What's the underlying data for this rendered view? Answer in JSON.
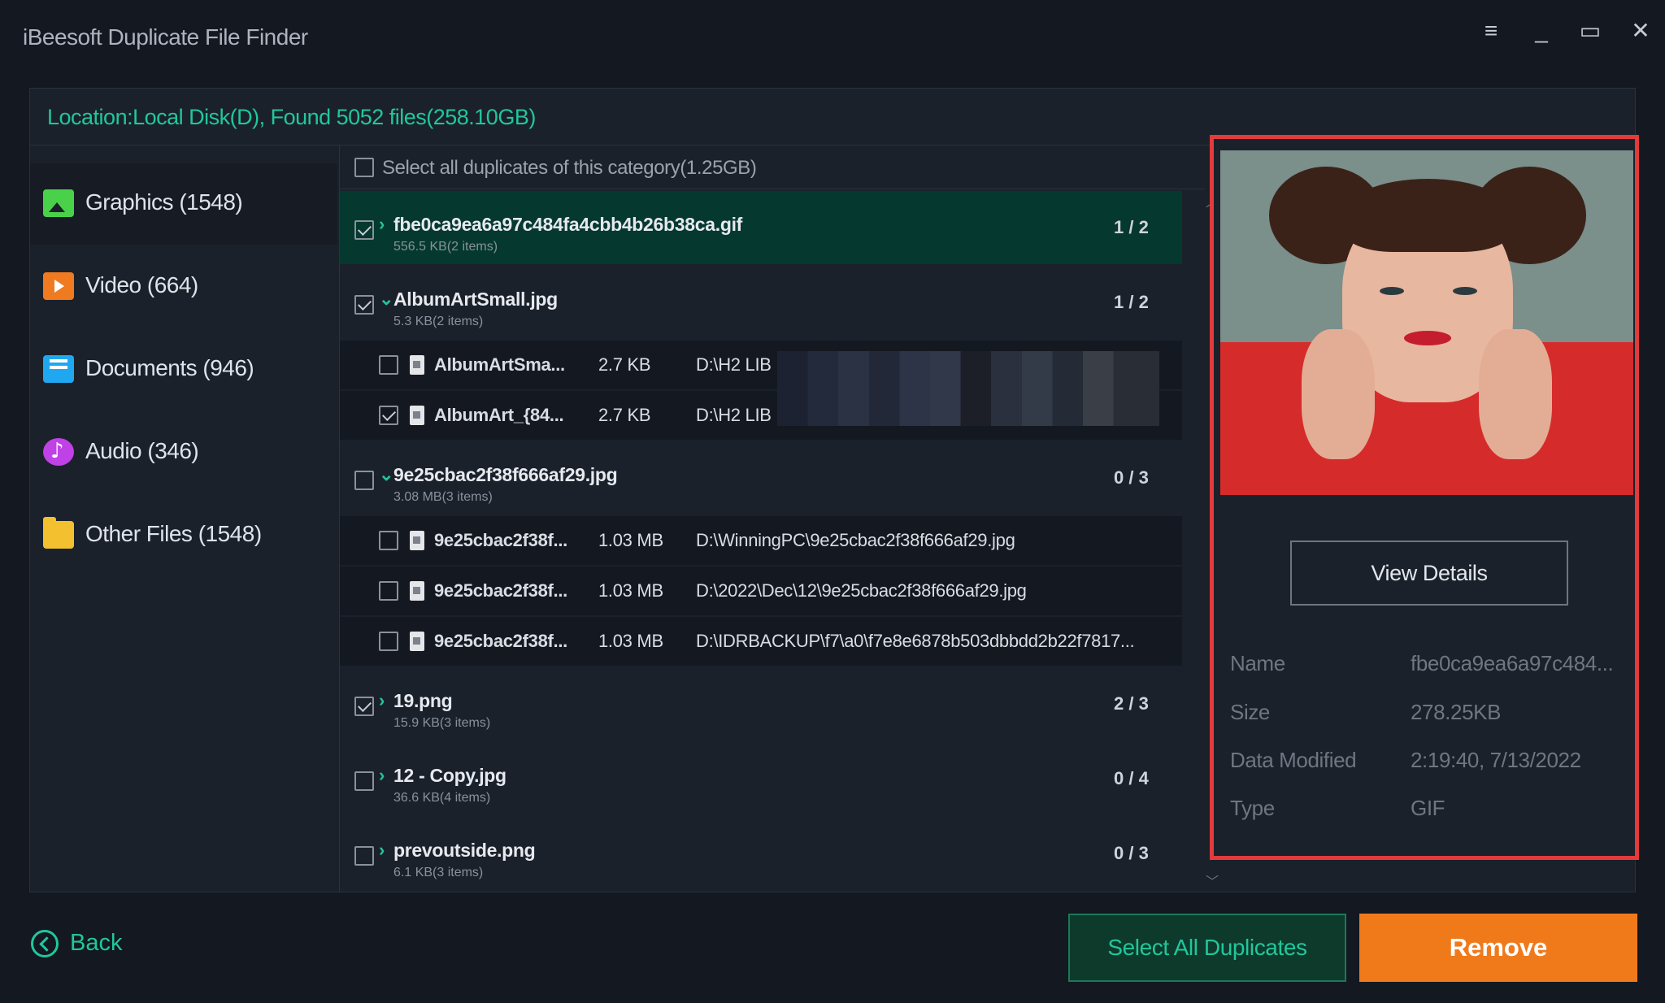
{
  "app": {
    "title": "iBeesoft Duplicate File Finder"
  },
  "location": {
    "text": "Location:Local Disk(D), Found 5052 files(258.10GB)"
  },
  "sidebar": {
    "items": [
      {
        "label": "Graphics (1548)",
        "icon": "graphics-icon"
      },
      {
        "label": "Video (664)",
        "icon": "video-icon"
      },
      {
        "label": "Documents (946)",
        "icon": "documents-icon"
      },
      {
        "label": "Audio (346)",
        "icon": "audio-icon"
      },
      {
        "label": "Other Files (1548)",
        "icon": "folder-icon"
      }
    ]
  },
  "list": {
    "select_all_label": "Select all duplicates of this category(1.25GB)",
    "groups": [
      {
        "name": "fbe0ca9ea6a97c484fa4cbb4b26b38ca.gif",
        "meta": "556.5 KB(2 items)",
        "count": "1 / 2",
        "arrow": "›"
      },
      {
        "name": "AlbumArtSmall.jpg",
        "meta": "5.3 KB(2 items)",
        "count": "1 / 2",
        "arrow": "⌄"
      },
      {
        "name": "9e25cbac2f38f666af29.jpg",
        "meta": "3.08 MB(3 items)",
        "count": "0 / 3",
        "arrow": "⌄"
      },
      {
        "name": "19.png",
        "meta": "15.9 KB(3 items)",
        "count": "2 / 3",
        "arrow": "›"
      },
      {
        "name": "12 - Copy.jpg",
        "meta": "36.6 KB(4 items)",
        "count": "0 / 4",
        "arrow": "›"
      },
      {
        "name": "prevoutside.png",
        "meta": "6.1 KB(3 items)",
        "count": "0 / 3",
        "arrow": "›"
      }
    ],
    "files": [
      {
        "name": "AlbumArtSma...",
        "size": "2.7 KB",
        "path": "D:\\H2 LIB"
      },
      {
        "name": "AlbumArt_{84...",
        "size": "2.7 KB",
        "path": "D:\\H2 LIB"
      },
      {
        "name": "9e25cbac2f38f...",
        "size": "1.03 MB",
        "path": "D:\\WinningPC\\9e25cbac2f38f666af29.jpg"
      },
      {
        "name": "9e25cbac2f38f...",
        "size": "1.03 MB",
        "path": "D:\\2022\\Dec\\12\\9e25cbac2f38f666af29.jpg"
      },
      {
        "name": "9e25cbac2f38f...",
        "size": "1.03 MB",
        "path": "D:\\IDRBACKUP\\f7\\a0\\f7e8e6878b503dbbdd2b22f7817..."
      }
    ]
  },
  "preview": {
    "view_details_label": "View Details",
    "info": [
      {
        "key": "Name",
        "value": "fbe0ca9ea6a97c484..."
      },
      {
        "key": "Size",
        "value": "278.25KB"
      },
      {
        "key": "Data Modified",
        "value": "2:19:40,  7/13/2022"
      },
      {
        "key": "Type",
        "value": "GIF"
      }
    ]
  },
  "footer": {
    "back_label": "Back",
    "select_all_duplicates_label": "Select All Duplicates",
    "remove_label": "Remove"
  },
  "colors": {
    "accent": "#21c79b",
    "remove": "#f07a1a",
    "highlight_border": "#e23b3b",
    "selected_row": "#05382f"
  }
}
